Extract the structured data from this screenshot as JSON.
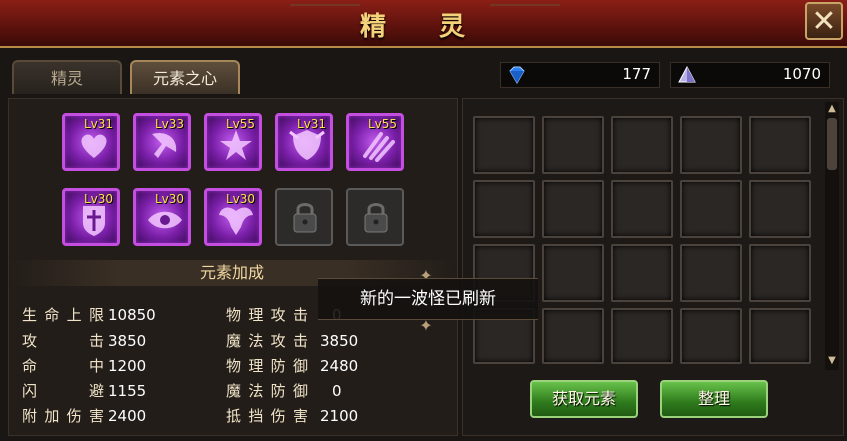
{
  "window": {
    "title": "精 灵"
  },
  "tabs": [
    {
      "label": "精灵"
    },
    {
      "label": "元素之心"
    }
  ],
  "currency": [
    {
      "icon": "diamond-icon",
      "value": "177"
    },
    {
      "icon": "crystal-icon",
      "value": "1070"
    }
  ],
  "elements": [
    {
      "level": "Lv31",
      "icon": "heart-element-icon"
    },
    {
      "level": "Lv33",
      "icon": "axe-element-icon"
    },
    {
      "level": "Lv55",
      "icon": "star-element-icon"
    },
    {
      "level": "Lv31",
      "icon": "shield-element-icon"
    },
    {
      "level": "Lv55",
      "icon": "claw-element-icon"
    },
    {
      "level": "Lv30",
      "icon": "cross-shield-element-icon"
    },
    {
      "level": "Lv30",
      "icon": "eye-element-icon"
    },
    {
      "level": "Lv30",
      "icon": "wing-element-icon"
    },
    {
      "level": "",
      "icon": "lock-icon"
    },
    {
      "level": "",
      "icon": "lock-icon"
    }
  ],
  "bonus": {
    "title": "元素加成",
    "left": [
      {
        "label": "生命上限",
        "value": "10850"
      },
      {
        "label": "攻击",
        "value": "3850"
      },
      {
        "label": "命中",
        "value": "1200"
      },
      {
        "label": "闪避",
        "value": "1155"
      },
      {
        "label": "附加伤害",
        "value": "2400"
      }
    ],
    "right": [
      {
        "label": "物理攻击",
        "value": "0"
      },
      {
        "label": "魔法攻击",
        "value": "3850"
      },
      {
        "label": "物理防御",
        "value": "2480"
      },
      {
        "label": "魔法防御",
        "value": "0"
      },
      {
        "label": "抵挡伤害",
        "value": "2100"
      }
    ]
  },
  "toast": {
    "message": "新的一波怪已刷新"
  },
  "buttons": {
    "get_element": "获取元素",
    "sort": "整理"
  },
  "colors": {
    "accent_purple": "#c44ee0",
    "level_text": "#ffe14a",
    "button_green": "#3f9a2a"
  }
}
